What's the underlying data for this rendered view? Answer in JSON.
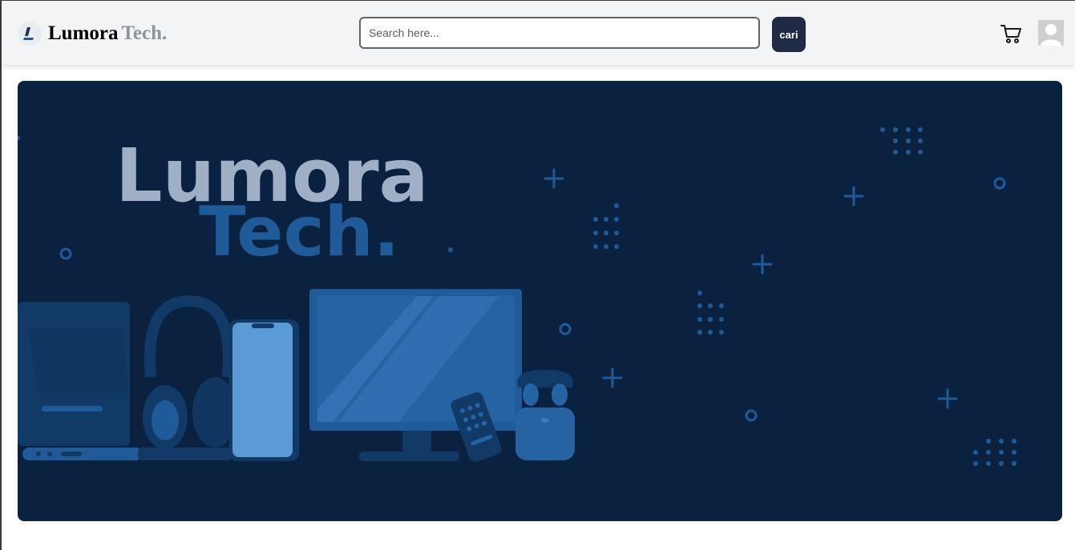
{
  "navbar": {
    "brand": {
      "name": "Lumora",
      "suffix": "Tech."
    },
    "search": {
      "placeholder": "Search here...",
      "value": ""
    },
    "search_button_label": "cari",
    "icons": {
      "logo": "brand-logo-icon",
      "cart": "cart-icon",
      "avatar": "user-avatar-icon"
    }
  },
  "hero": {
    "title_line1": "Lumora",
    "title_line2": "Tech.",
    "colors": {
      "background": "#0a2240",
      "title_line1": "#9fb0c6",
      "title_line2": "#1f5a99"
    }
  }
}
